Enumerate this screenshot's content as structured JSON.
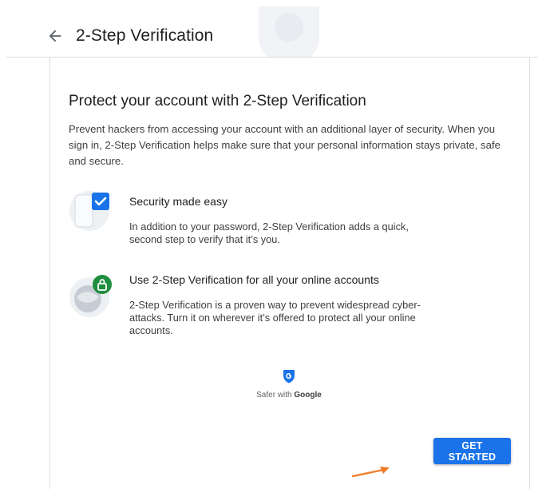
{
  "header": {
    "title": "2-Step Verification",
    "back_icon": "arrow-left-icon"
  },
  "card": {
    "heading": "Protect your account with 2-Step Verification",
    "intro": "Prevent hackers from accessing your account with an additional layer of security. When you sign in, 2-Step Verification helps make sure that your personal information stays private, safe and secure.",
    "features": [
      {
        "icon": "checkbox-phone-icon",
        "title": "Security made easy",
        "description": "In addition to your password, 2-Step Verification adds a quick, second step to verify that it’s you."
      },
      {
        "icon": "lock-globe-icon",
        "title": "Use 2-Step Verification for all your online accounts",
        "description": "2-Step Verification is a proven way to prevent widespread cyber-attacks. Turn it on wherever it’s offered to protect all your online accounts."
      }
    ],
    "safer_with": "Safer with",
    "safer_brand": "Google",
    "cta": "GET STARTED"
  },
  "colors": {
    "accent": "#1a73e8",
    "lock_green": "#1e8e3e",
    "shield_blue": "#1a5ec6"
  }
}
